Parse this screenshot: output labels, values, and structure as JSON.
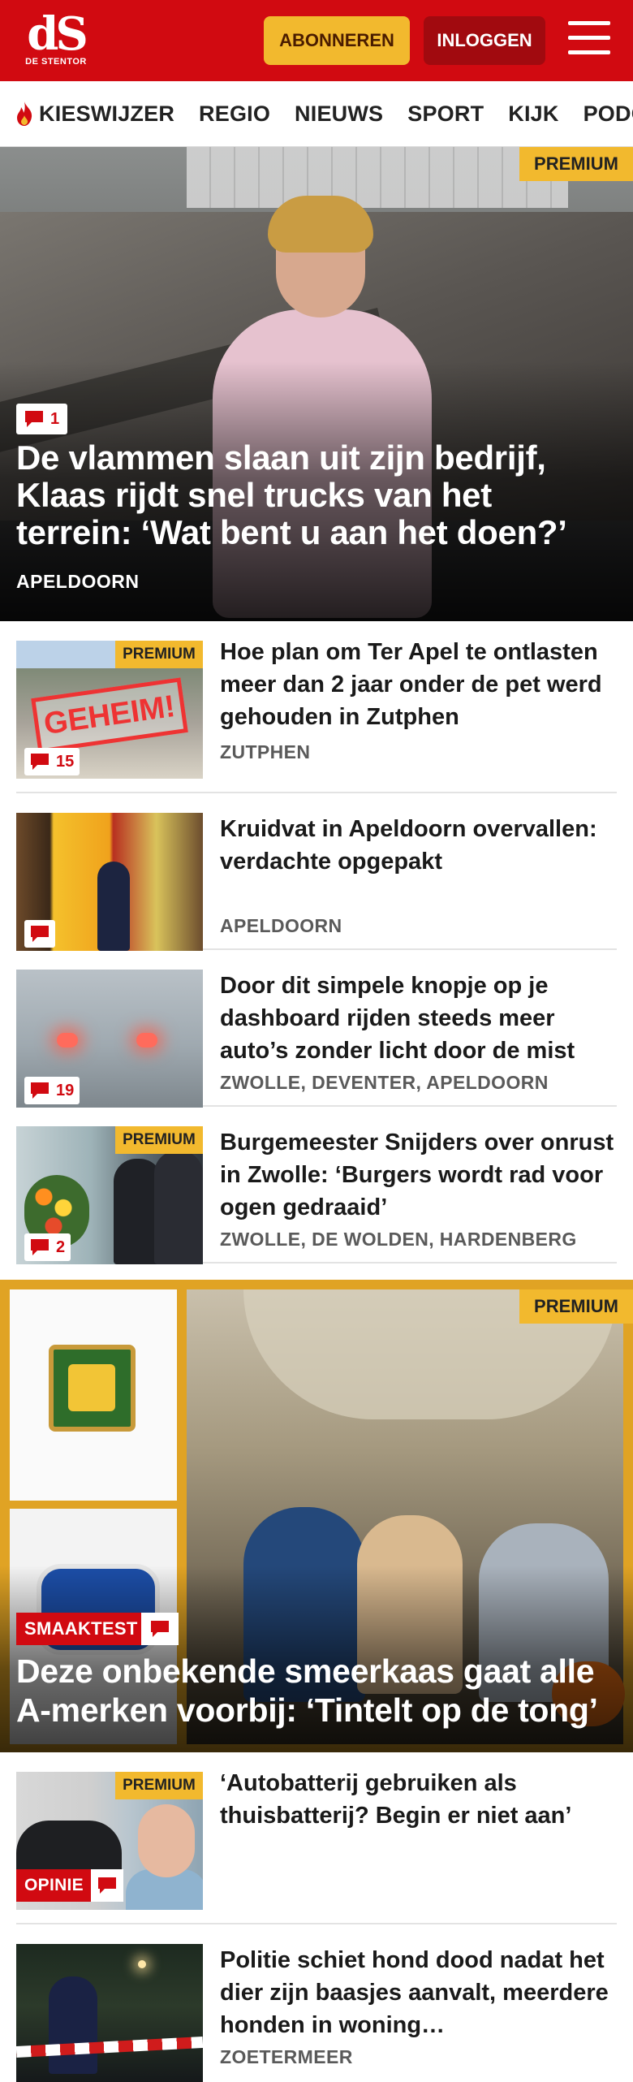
{
  "header": {
    "logo_mark": "dS",
    "logo_text": "DE STENTOR",
    "subscribe_label": "ABONNEREN",
    "login_label": "INLOGGEN",
    "brand_color": "#d10a11",
    "accent_color": "#f2b92e"
  },
  "nav": {
    "items": [
      {
        "label": "KIESWIJZER",
        "icon": "flame-icon"
      },
      {
        "label": "REGIO"
      },
      {
        "label": "NIEUWS"
      },
      {
        "label": "SPORT"
      },
      {
        "label": "KIJK"
      },
      {
        "label": "PODCAS"
      }
    ]
  },
  "hero": {
    "premium": "PREMIUM",
    "comments": "1",
    "title": "De vlammen slaan uit zijn bedrijf, Klaas rijdt snel trucks van het terrein: ‘Wat bent u aan het doen?’",
    "location": "APELDOORN"
  },
  "articles": [
    {
      "premium": "PREMIUM",
      "stamp": "GEHEIM!",
      "comments": "15",
      "title": "Hoe plan om Ter Apel te ontlasten meer dan 2 jaar onder de pet werd gehouden in Zutphen",
      "location": "ZUTPHEN"
    },
    {
      "comments": "",
      "title": "Kruidvat in Apeldoorn overvallen: verdachte opgepakt",
      "location": "APELDOORN"
    },
    {
      "comments": "19",
      "title": "Door dit simpele knopje op je dashboard rijden steeds meer auto’s zonder licht door de mist",
      "location": "ZWOLLE, DEVENTER, APELDOORN"
    },
    {
      "premium": "PREMIUM",
      "comments": "2",
      "title": "Burgemeester Snijders over onrust in Zwolle: ‘Burgers wordt rad voor ogen gedraaid’",
      "location": "ZWOLLE, DE WOLDEN, HARDENBERG"
    }
  ],
  "feature": {
    "premium": "PREMIUM",
    "label": "SMAAKTEST",
    "title": "Deze onbekende smeerkaas gaat alle A-merken voorbij: ‘Tintelt op de tong’"
  },
  "articles2": [
    {
      "premium": "PREMIUM",
      "label": "OPINIE",
      "title": "‘Autobatterij gebruiken als thuisbatterij? Begin er niet aan’",
      "location": ""
    },
    {
      "title": "Politie schiet hond dood nadat het dier zijn baasjes aanvalt, meerdere honden in woning…",
      "location": "ZOETERMEER"
    }
  ]
}
